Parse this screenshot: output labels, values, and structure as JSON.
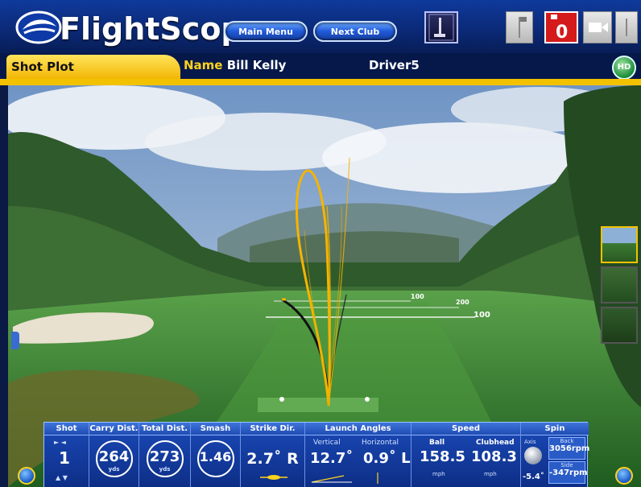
{
  "header": {
    "brand": "FlightScope",
    "main_menu_label": "Main Menu",
    "next_club_label": "Next Club",
    "red_button_value": "0"
  },
  "tabs": {
    "active_label": "Shot Plot",
    "player_key": "Name",
    "player_name": "Bill Kelly",
    "club": "Driver5",
    "help_label": "HD"
  },
  "scene": {
    "distance_markers": [
      "100",
      "200",
      "100"
    ]
  },
  "stats": {
    "shot": {
      "header": "Shot",
      "value": "1",
      "arrows": "► ◄",
      "arrows2": "▲ ▼"
    },
    "carry": {
      "header": "Carry Dist.",
      "value": "264",
      "unit": "yds"
    },
    "total": {
      "header": "Total Dist.",
      "value": "273",
      "unit": "yds"
    },
    "smash": {
      "header": "Smash",
      "value": "1.46"
    },
    "strike": {
      "header": "Strike Dir.",
      "value": "2.7˚ R"
    },
    "launch": {
      "header": "Launch Angles",
      "vertical_label": "Vertical",
      "vertical_value": "12.7˚",
      "horizontal_label": "Horizontal",
      "horizontal_value": "0.9˚ L"
    },
    "speed": {
      "header": "Speed",
      "ball_label": "Ball",
      "ball_value": "158.5",
      "ball_unit": "mph",
      "club_label": "Clubhead",
      "club_value": "108.3",
      "club_unit": "mph"
    },
    "spin": {
      "header": "Spin",
      "axis_label": "Axis",
      "axis_value": "-5.4˚",
      "back_label": "Back",
      "back_value": "3056rpm",
      "side_label": "Side",
      "side_value": "-347rpm"
    }
  },
  "colors": {
    "header_blue": "#0b2a78",
    "accent_yellow": "#f2c200",
    "trace_yellow": "#f5b400"
  }
}
